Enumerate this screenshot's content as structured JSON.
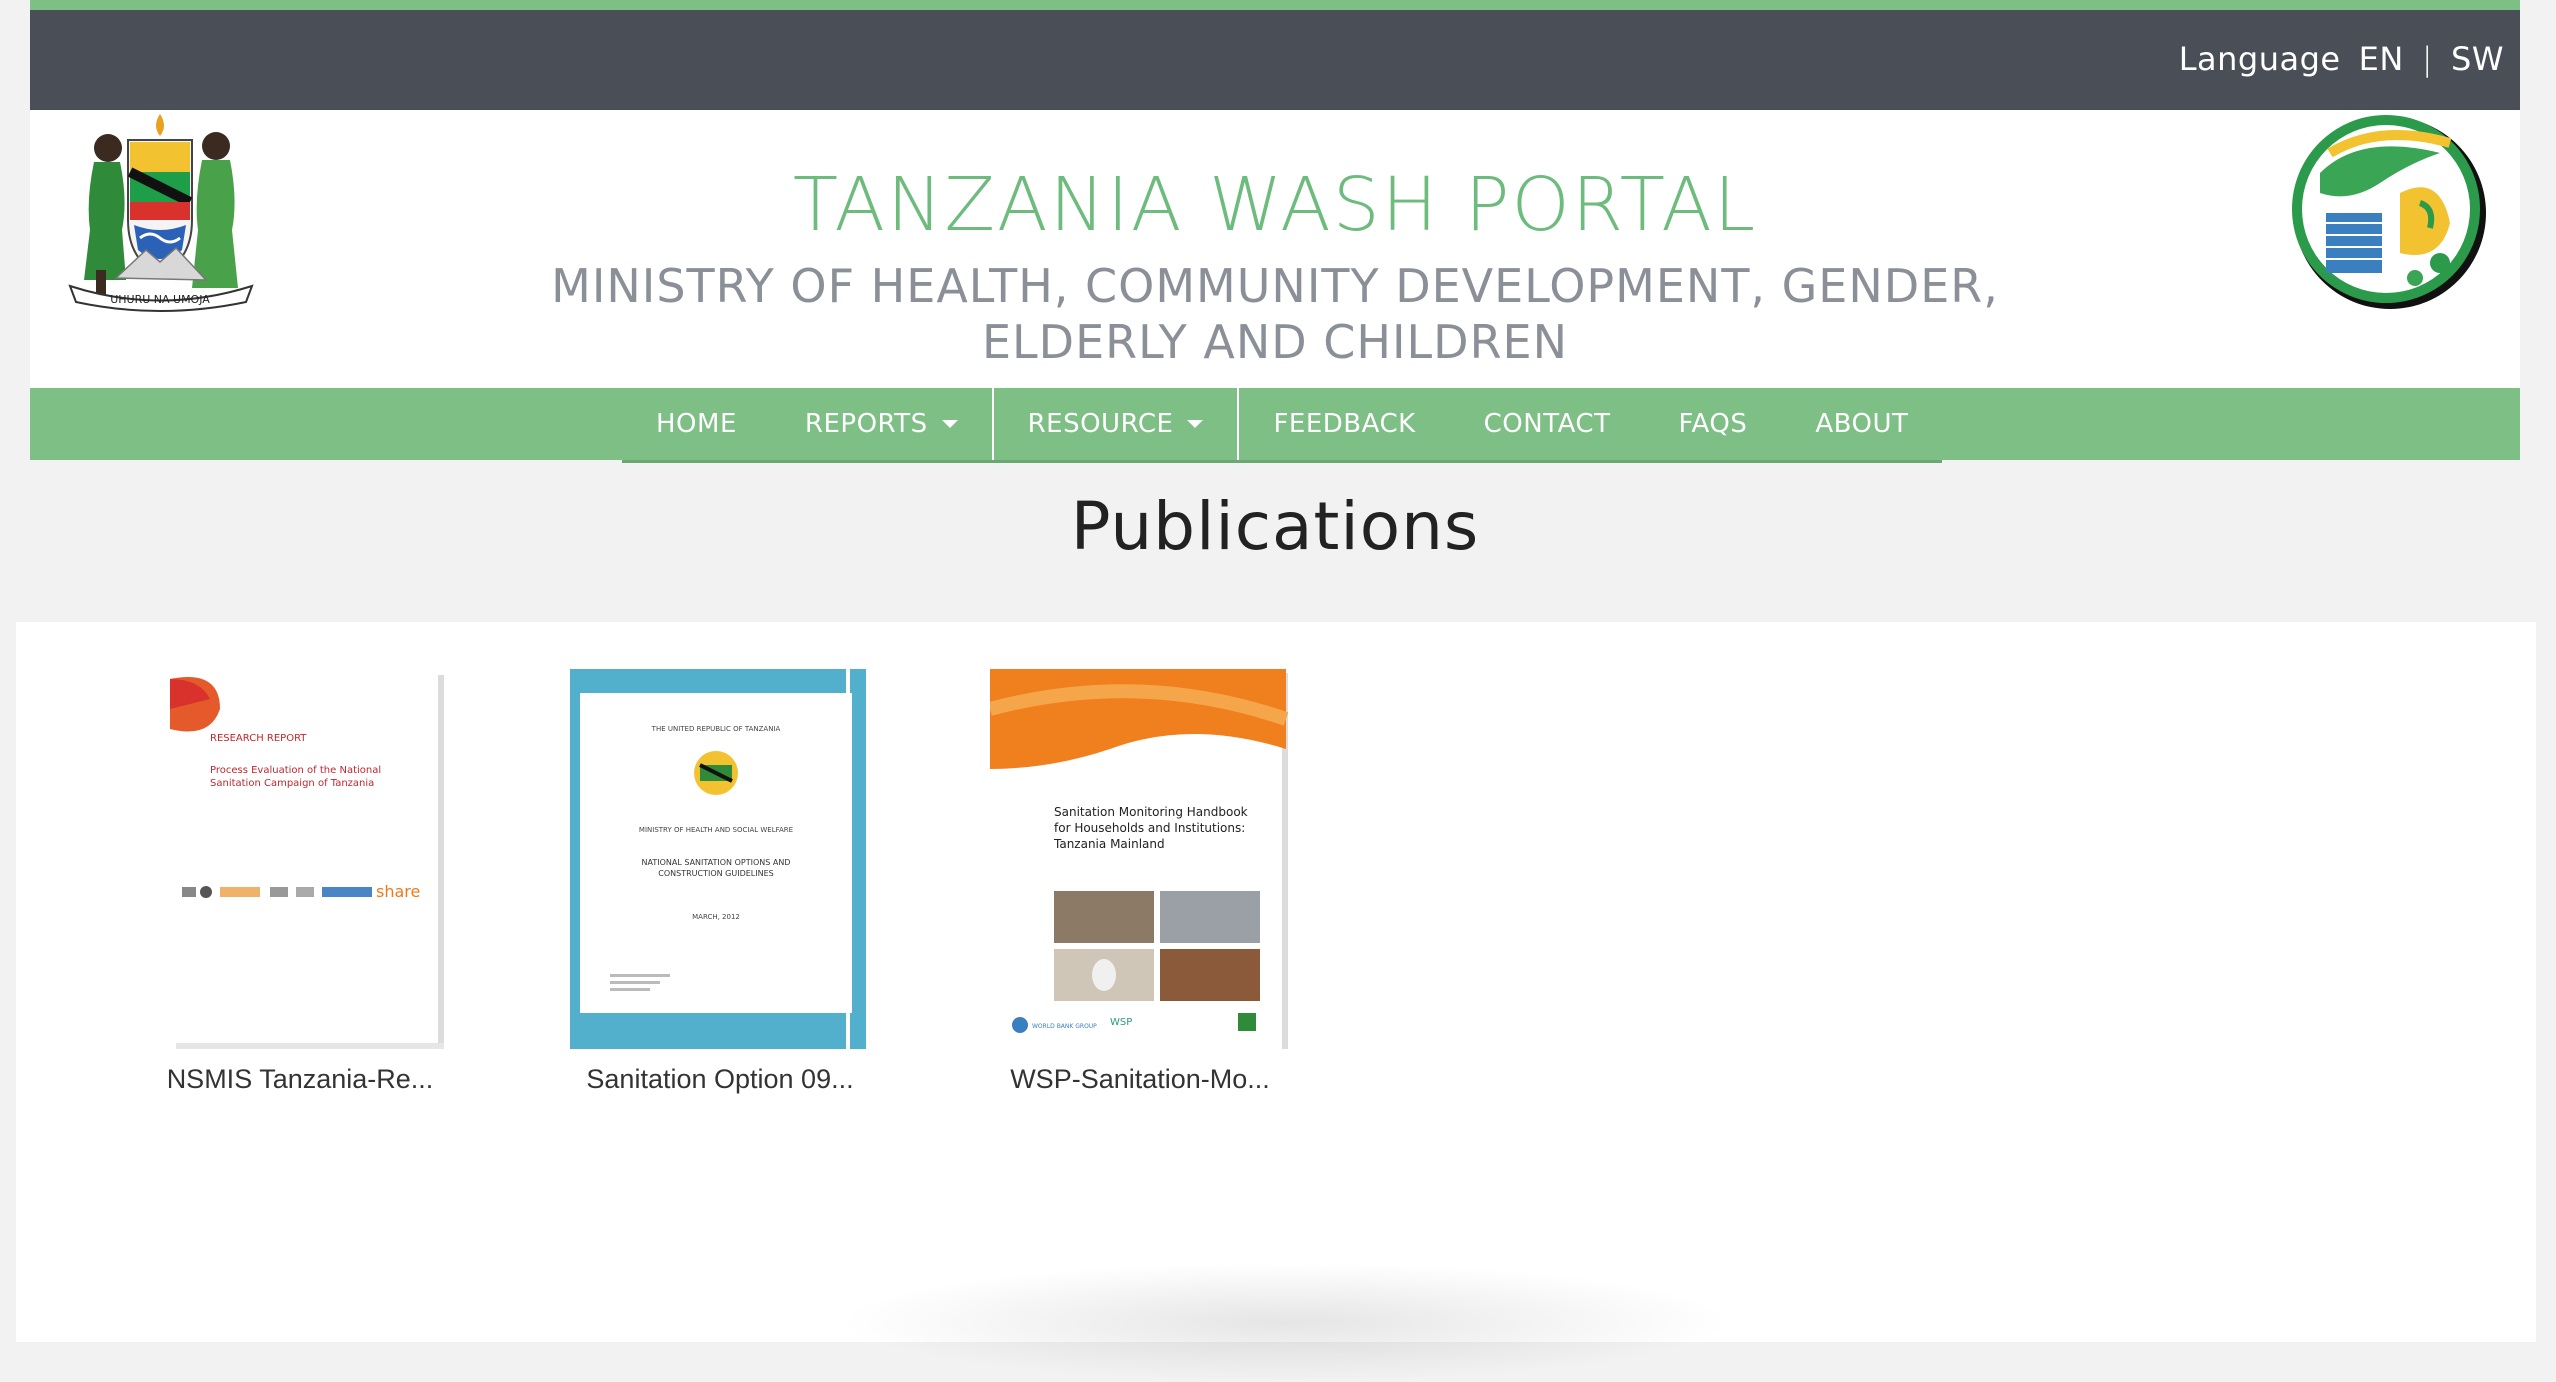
{
  "topbar": {
    "language_label": "Language",
    "lang_en": "EN",
    "separator": "|",
    "lang_sw": "SW"
  },
  "header": {
    "title": "TANZANIA WASH PORTAL",
    "ministry_line1": "MINISTRY OF HEALTH, COMMUNITY DEVELOPMENT, GENDER,",
    "ministry_line2": "ELDERLY AND CHILDREN",
    "crest_ribbon": "UHURU NA UMOJA"
  },
  "nav": {
    "items": [
      {
        "label": "HOME",
        "dropdown": false
      },
      {
        "label": "REPORTS",
        "dropdown": true
      },
      {
        "label": "RESOURCE",
        "dropdown": true,
        "active": true
      },
      {
        "label": "FEEDBACK",
        "dropdown": false
      },
      {
        "label": "CONTACT",
        "dropdown": false
      },
      {
        "label": "FAQS",
        "dropdown": false
      },
      {
        "label": "ABOUT",
        "dropdown": false
      }
    ]
  },
  "page": {
    "heading": "Publications"
  },
  "publications": [
    {
      "caption": "NSMIS Tanzania-Re...",
      "cover_line1": "RESEARCH REPORT",
      "cover_line2": "Process Evaluation of the National",
      "cover_line3": "Sanitation Campaign of Tanzania",
      "cover_logo": "share"
    },
    {
      "caption": "Sanitation Option 09...",
      "cover_line1": "THE UNITED REPUBLIC OF TANZANIA",
      "cover_line2": "MINISTRY OF HEALTH AND SOCIAL WELFARE",
      "cover_line3": "NATIONAL SANITATION OPTIONS AND",
      "cover_line4": "CONSTRUCTION GUIDELINES",
      "cover_line5": "MARCH, 2012"
    },
    {
      "caption": "WSP-Sanitation-Mo...",
      "cover_line1": "Sanitation Monitoring Handbook",
      "cover_line2": "for Households and Institutions:",
      "cover_line3": "Tanzania Mainland",
      "cover_footer": "WORLD BANK GROUP",
      "cover_footer2": "WSP"
    }
  ],
  "colors": {
    "brand_green": "#7dbf85",
    "title_green": "#6dbb7d",
    "topbar_dark": "#4a4e57",
    "ministry_gray": "#8a8f98"
  }
}
